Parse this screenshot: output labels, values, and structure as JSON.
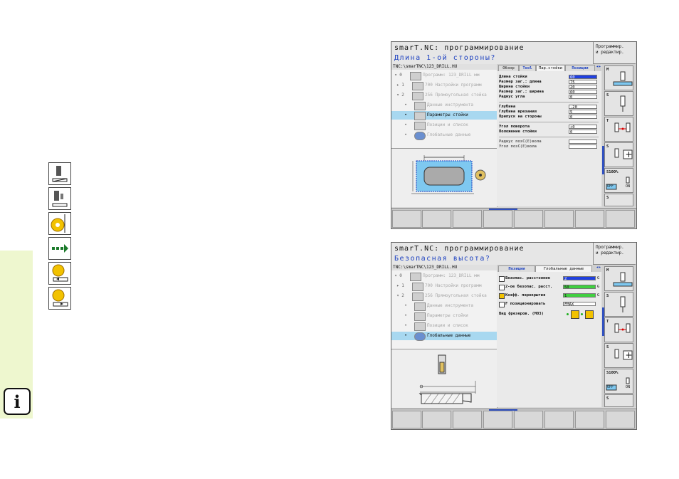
{
  "sidebar": {
    "info_label": "i"
  },
  "screens": [
    {
      "app_title": "smarT.NC: программирование",
      "prompt": "Длина 1-ой стороны?",
      "mode_label_1": "Программир.",
      "mode_label_2": "и редактир.",
      "path": "TNC:\\smarTNC\\123_DRILL.HU",
      "tree": [
        {
          "mark": "▾",
          "num": "0",
          "label": "Программ: 123_DRILL мм"
        },
        {
          "mark": "▸",
          "num": "1",
          "label": "700 Настройки программ"
        },
        {
          "mark": "▾",
          "num": "2",
          "label": "256 Прямоугольная стойка"
        },
        {
          "mark": "•",
          "num": "",
          "label": "Данные инструмента"
        },
        {
          "mark": "•",
          "num": "",
          "label": "Параметры стойки"
        },
        {
          "mark": "•",
          "num": "",
          "label": "Позиции и список"
        },
        {
          "mark": "•",
          "num": "",
          "label": "Глобальные данные"
        }
      ],
      "tabs": [
        "Обзор",
        "Tool",
        "Пар.стойки",
        "Позиции"
      ],
      "fields": [
        {
          "label": "Длина стойки",
          "value": "60"
        },
        {
          "label": "Размер заг.: длина",
          "value": "75"
        },
        {
          "label": "Ширина стойки",
          "value": "20"
        },
        {
          "label": "Размер заг.: ширина",
          "value": "60"
        },
        {
          "label": "Радиус угла",
          "value": "0"
        },
        {
          "label": "Глубина",
          "value": "-20"
        },
        {
          "label": "Глубина врезания",
          "value": "5"
        },
        {
          "label": "Припуск на стороны",
          "value": "0"
        },
        {
          "label": "Угол поворота",
          "value": "+0"
        },
        {
          "label": "Положение стойки",
          "value": "0"
        },
        {
          "label": "Радиус позC(E)вола",
          "value": ""
        },
        {
          "label": "Угол позC(E)вола",
          "value": ""
        }
      ],
      "rbtns": [
        "M",
        "S",
        "T",
        "S",
        "S100%",
        "S"
      ],
      "rbtn_extra": {
        "off": "OFF",
        "on": "ON"
      }
    },
    {
      "app_title": "smarT.NC: программирование",
      "prompt": "Безопасная высота?",
      "mode_label_1": "Программир.",
      "mode_label_2": "и редактир.",
      "path": "TNC:\\smarTNC\\123_DRILL.HU",
      "tree": [
        {
          "mark": "▾",
          "num": "0",
          "label": "Программ: 123_DRILL мм"
        },
        {
          "mark": "▸",
          "num": "1",
          "label": "700 Настройки программ"
        },
        {
          "mark": "▾",
          "num": "2",
          "label": "256 Прямоугольная стойка"
        },
        {
          "mark": "•",
          "num": "",
          "label": "Данные инструмента"
        },
        {
          "mark": "•",
          "num": "",
          "label": "Параметры стойки"
        },
        {
          "mark": "•",
          "num": "",
          "label": "Позиции и список"
        },
        {
          "mark": "•",
          "num": "",
          "label": "Глобальные данные"
        }
      ],
      "tabs": [
        "Позиции",
        "Глобальные данные"
      ],
      "fields": [
        {
          "label": "Безопас. расстояние",
          "value": "2",
          "suffix": "G"
        },
        {
          "label": "2-ое безопас. расст.",
          "value": "50",
          "suffix": "G"
        },
        {
          "label": "Коэфф. перекрытия",
          "value": "1",
          "suffix": "G"
        },
        {
          "label": "F позиционировать",
          "value": "FMAX",
          "suffix": ""
        },
        {
          "label": "Вид фрезеров. (M03)",
          "value": "",
          "suffix": ""
        }
      ],
      "rbtns": [
        "M",
        "S",
        "T",
        "S",
        "S100%",
        "S"
      ],
      "rbtn_extra": {
        "off": "OFF",
        "on": "ON"
      }
    }
  ]
}
